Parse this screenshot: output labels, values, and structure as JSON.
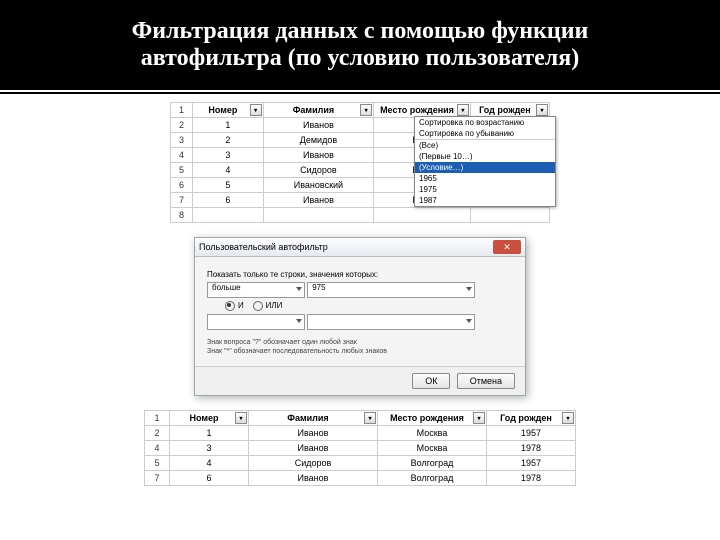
{
  "title_line1": "Фильтрация данных с помощью функции",
  "title_line2": "автофильтра (по условию пользователя)",
  "table": {
    "headers": [
      "Номер",
      "Фамилия",
      "Место рождения",
      "Год рожден"
    ],
    "rows_full": [
      {
        "n": "1",
        "num": "",
        "fam": "",
        "city": "",
        "year": ""
      },
      {
        "n": "2",
        "num": "1",
        "fam": "Иванов",
        "city": "Мо",
        "year": ""
      },
      {
        "n": "3",
        "num": "2",
        "fam": "Демидов",
        "city": "Волг",
        "year": ""
      },
      {
        "n": "4",
        "num": "3",
        "fam": "Иванов",
        "city": "Мо",
        "year": ""
      },
      {
        "n": "5",
        "num": "4",
        "fam": "Сидоров",
        "city": "Волг",
        "year": ""
      },
      {
        "n": "6",
        "num": "5",
        "fam": "Ивановский",
        "city": "Мо",
        "year": ""
      },
      {
        "n": "7",
        "num": "6",
        "fam": "Иванов",
        "city": "Волг",
        "year": ""
      },
      {
        "n": "8",
        "num": "",
        "fam": "",
        "city": "",
        "year": ""
      }
    ],
    "rows_filtered": [
      {
        "n": "1",
        "num": "",
        "fam": "",
        "city": "",
        "year": ""
      },
      {
        "n": "2",
        "num": "1",
        "fam": "Иванов",
        "city": "Москва",
        "year": "1957"
      },
      {
        "n": "4",
        "num": "3",
        "fam": "Иванов",
        "city": "Москва",
        "year": "1978"
      },
      {
        "n": "5",
        "num": "4",
        "fam": "Сидоров",
        "city": "Волгоград",
        "year": "1957"
      },
      {
        "n": "7",
        "num": "6",
        "fam": "Иванов",
        "city": "Волгоград",
        "year": "1978"
      }
    ]
  },
  "dropdown": {
    "items": [
      {
        "t": "Сортировка по возрастанию"
      },
      {
        "t": "Сортировка по убыванию"
      },
      {
        "sep": true
      },
      {
        "t": "(Все)"
      },
      {
        "t": "(Первые 10…)"
      },
      {
        "t": "(Условие…)",
        "sel": true
      },
      {
        "t": "1965"
      },
      {
        "t": "1975"
      },
      {
        "t": "1987"
      }
    ]
  },
  "dialog": {
    "title": "Пользовательский автофильтр",
    "subtitle": "Показать только те строки, значения которых:",
    "field_label": "…",
    "op1": "больше",
    "val1": "975",
    "radio_and": "И",
    "radio_or": "ИЛИ",
    "op2": "",
    "val2": "",
    "hint1": "Знак вопроса \"?\" обозначает один любой знак",
    "hint2": "Знак \"*\" обозначает последовательность любых знаков",
    "ok": "ОК",
    "cancel": "Отмена"
  }
}
